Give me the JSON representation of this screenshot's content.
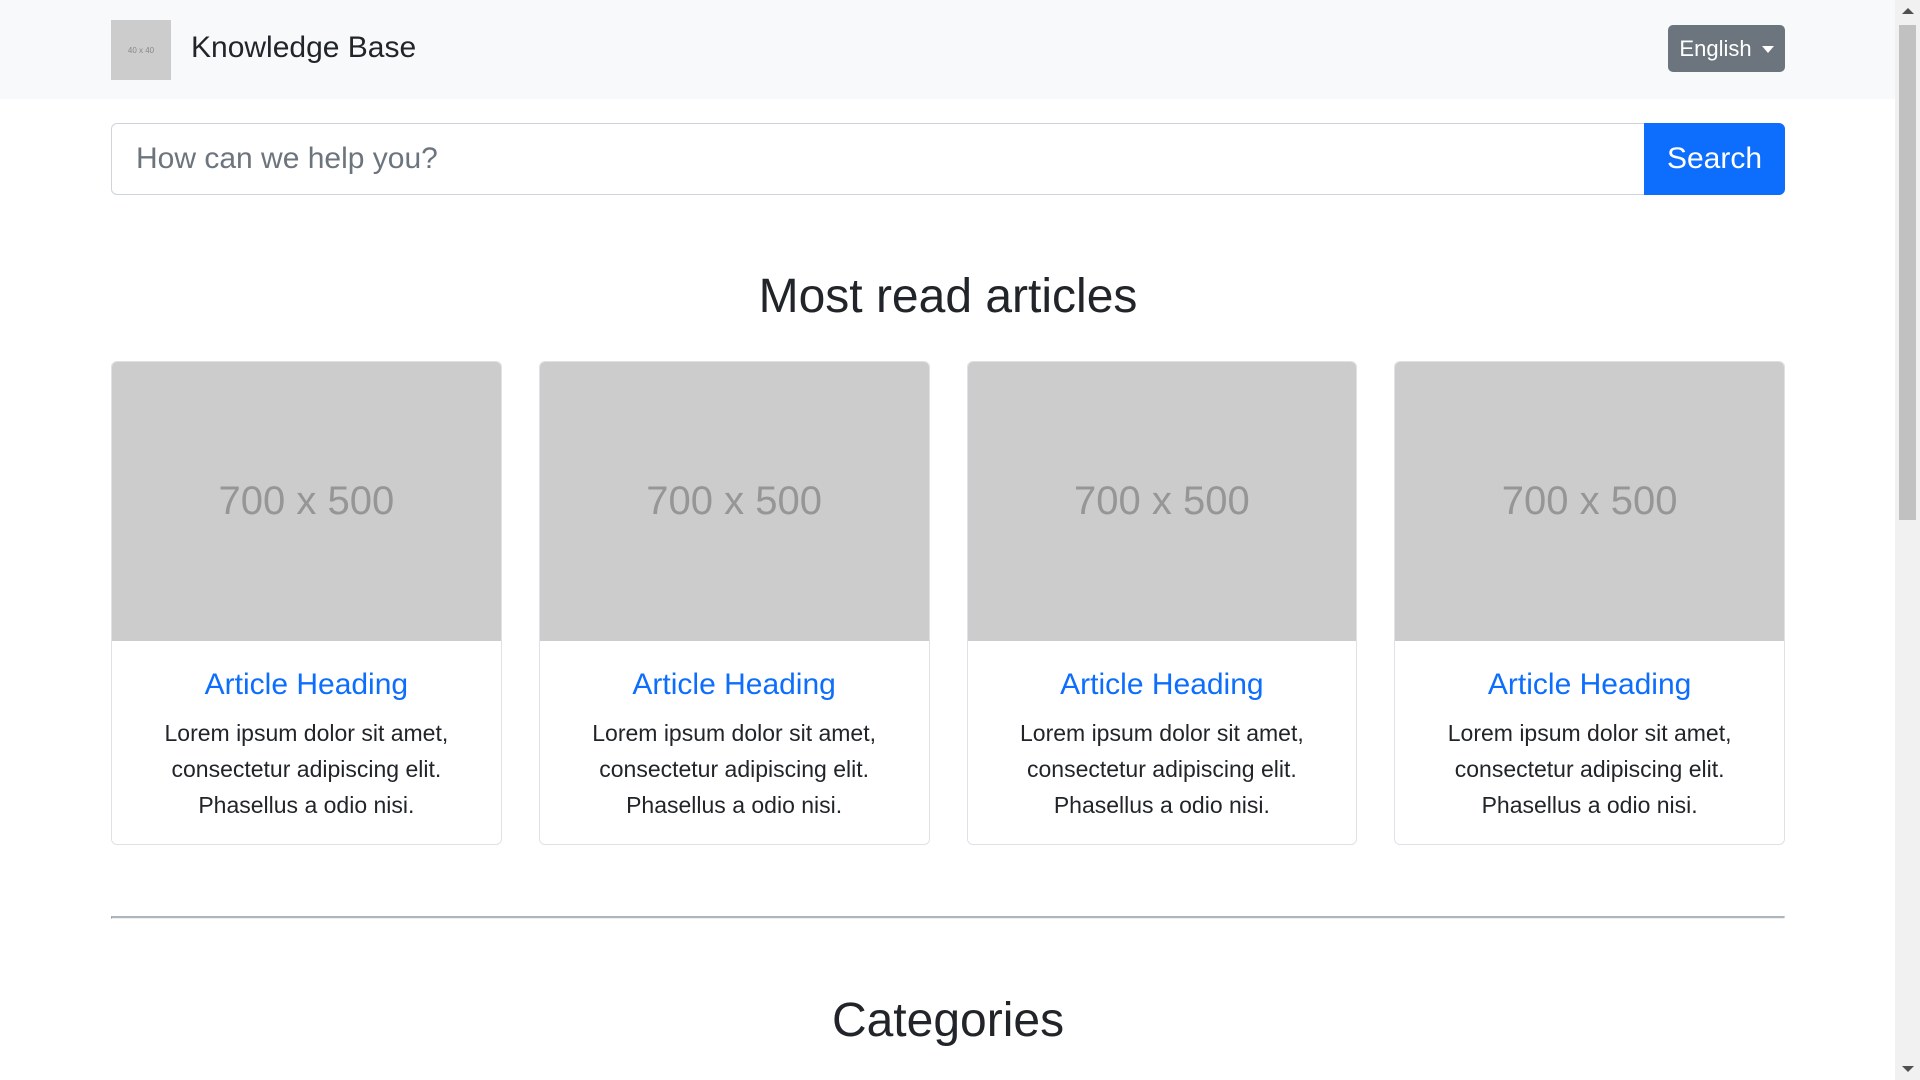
{
  "navbar": {
    "logo_text": "40 x 40",
    "brand": "Knowledge Base",
    "language_selected": "English"
  },
  "search": {
    "placeholder": "How can we help you?",
    "button_label": "Search"
  },
  "sections": {
    "articles_title": "Most read articles",
    "categories_title": "Categories"
  },
  "articles": [
    {
      "image_label": "700 x 500",
      "title": "Article Heading",
      "text": "Lorem ipsum dolor sit amet, consectetur adipiscing elit. Phasellus a odio nisi."
    },
    {
      "image_label": "700 x 500",
      "title": "Article Heading",
      "text": "Lorem ipsum dolor sit amet, consectetur adipiscing elit. Phasellus a odio nisi."
    },
    {
      "image_label": "700 x 500",
      "title": "Article Heading",
      "text": "Lorem ipsum dolor sit amet, consectetur adipiscing elit. Phasellus a odio nisi."
    },
    {
      "image_label": "700 x 500",
      "title": "Article Heading",
      "text": "Lorem ipsum dolor sit amet, consectetur adipiscing elit. Phasellus a odio nisi."
    }
  ],
  "colors": {
    "primary": "#0d6efd",
    "secondary": "#6c757d",
    "navbar_bg": "#f8f9fa",
    "placeholder_img": "#cccccc"
  }
}
